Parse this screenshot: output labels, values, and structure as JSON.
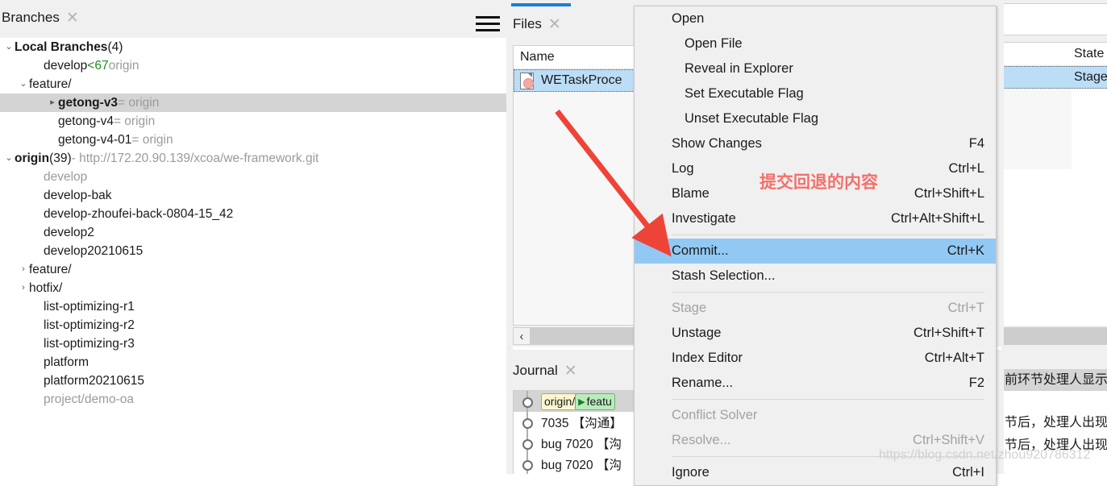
{
  "branches_panel": {
    "tab": {
      "label": "Branches",
      "close_icon": "close-icon",
      "close_glyph": "✕"
    },
    "menu_icon": "hamburger-menu-icon",
    "rows": [
      {
        "twisty": "⌄",
        "indent": 0,
        "text": "Local Branches",
        "bold": true,
        "suffix": " (4)",
        "selected": false
      },
      {
        "twisty": "",
        "indent": 2,
        "text": "develop",
        "bold": false,
        "ahead": "<67",
        "remote": "origin",
        "selected": false
      },
      {
        "twisty": "⌄",
        "indent": 1,
        "text": "feature/",
        "bold": false,
        "selected": false
      },
      {
        "twisty": "▸",
        "indent": 3,
        "text": "getong-v3",
        "bold": true,
        "eq": "= origin",
        "selected": true
      },
      {
        "twisty": "",
        "indent": 3,
        "text": "getong-v4",
        "bold": false,
        "eq": "= origin",
        "selected": false
      },
      {
        "twisty": "",
        "indent": 3,
        "text": "getong-v4-01",
        "bold": false,
        "eq": "= origin",
        "selected": false
      },
      {
        "twisty": "⌄",
        "indent": 0,
        "text": "origin",
        "bold": true,
        "suffix": " (39)",
        "url": "- http://172.20.90.139/xcoa/we-framework.git",
        "selected": false
      },
      {
        "twisty": "",
        "indent": 2,
        "text": "develop",
        "bold": false,
        "dim": true,
        "selected": false
      },
      {
        "twisty": "",
        "indent": 2,
        "text": "develop-bak",
        "bold": false,
        "selected": false
      },
      {
        "twisty": "",
        "indent": 2,
        "text": "develop-zhoufei-back-0804-15_42",
        "bold": false,
        "selected": false
      },
      {
        "twisty": "",
        "indent": 2,
        "text": "develop2",
        "bold": false,
        "selected": false
      },
      {
        "twisty": "",
        "indent": 2,
        "text": "develop20210615",
        "bold": false,
        "selected": false
      },
      {
        "twisty": "›",
        "indent": 1,
        "text": "feature/",
        "bold": false,
        "selected": false
      },
      {
        "twisty": "›",
        "indent": 1,
        "text": "hotfix/",
        "bold": false,
        "selected": false
      },
      {
        "twisty": "",
        "indent": 2,
        "text": "list-optimizing-r1",
        "bold": false,
        "selected": false
      },
      {
        "twisty": "",
        "indent": 2,
        "text": "list-optimizing-r2",
        "bold": false,
        "selected": false
      },
      {
        "twisty": "",
        "indent": 2,
        "text": "list-optimizing-r3",
        "bold": false,
        "selected": false
      },
      {
        "twisty": "",
        "indent": 2,
        "text": "platform",
        "bold": false,
        "selected": false
      },
      {
        "twisty": "",
        "indent": 2,
        "text": "platform20210615",
        "bold": false,
        "selected": false
      },
      {
        "twisty": "",
        "indent": 2,
        "text": "project/demo-oa",
        "bold": false,
        "dim": true,
        "selected": false
      }
    ]
  },
  "files_panel": {
    "tab": {
      "label": "Files",
      "close_icon": "close-icon",
      "close_glyph": "✕"
    },
    "columns": {
      "name": "Name",
      "state": "State"
    },
    "rows": [
      {
        "icon": "modified-file-icon",
        "name": "WETaskProce",
        "state": "Staged"
      }
    ],
    "hscroll": {
      "left_arrow_glyph": "‹"
    }
  },
  "journal_panel": {
    "tab": {
      "label": "Journal",
      "close_icon": "close-icon",
      "close_glyph": "✕"
    },
    "rows": [
      {
        "selected": true,
        "ref_local": "origin/",
        "ref_remote": "featu",
        "message": ""
      },
      {
        "selected": false,
        "message": "7035 【沟通】"
      },
      {
        "selected": false,
        "message": "bug 7020 【沟"
      },
      {
        "selected": false,
        "message": "bug 7020 【沟"
      }
    ]
  },
  "right_panel": {
    "column_header": "State",
    "row_value": "Staged",
    "text_lines": [
      {
        "text": "前环节处理人显示",
        "highlight": true
      },
      {
        "text": "节后，处理人出现",
        "highlight": false
      },
      {
        "text": "节后，处理人出现",
        "highlight": false
      }
    ]
  },
  "context_menu": {
    "items": [
      {
        "label": "Open",
        "accel": "",
        "state": "normal",
        "sub": false,
        "sep_after": false
      },
      {
        "label": "Open File",
        "accel": "",
        "state": "normal",
        "sub": true,
        "sep_after": false
      },
      {
        "label": "Reveal in Explorer",
        "accel": "",
        "state": "normal",
        "sub": true,
        "sep_after": false
      },
      {
        "label": "Set Executable Flag",
        "accel": "",
        "state": "normal",
        "sub": true,
        "sep_after": false
      },
      {
        "label": "Unset Executable Flag",
        "accel": "",
        "state": "normal",
        "sub": true,
        "sep_after": false
      },
      {
        "label": "Show Changes",
        "accel": "F4",
        "state": "normal",
        "sub": false,
        "sep_after": false
      },
      {
        "label": "Log",
        "accel": "Ctrl+L",
        "state": "normal",
        "sub": false,
        "sep_after": false
      },
      {
        "label": "Blame",
        "accel": "Ctrl+Shift+L",
        "state": "normal",
        "sub": false,
        "sep_after": false
      },
      {
        "label": "Investigate",
        "accel": "Ctrl+Alt+Shift+L",
        "state": "normal",
        "sub": false,
        "sep_after": true
      },
      {
        "label": "Commit...",
        "accel": "Ctrl+K",
        "state": "highlighted",
        "sub": false,
        "sep_after": false
      },
      {
        "label": "Stash Selection...",
        "accel": "",
        "state": "normal",
        "sub": false,
        "sep_after": true
      },
      {
        "label": "Stage",
        "accel": "Ctrl+T",
        "state": "disabled",
        "sub": false,
        "sep_after": false
      },
      {
        "label": "Unstage",
        "accel": "Ctrl+Shift+T",
        "state": "normal",
        "sub": false,
        "sep_after": false
      },
      {
        "label": "Index Editor",
        "accel": "Ctrl+Alt+T",
        "state": "normal",
        "sub": false,
        "sep_after": false
      },
      {
        "label": "Rename...",
        "accel": "F2",
        "state": "normal",
        "sub": false,
        "sep_after": true
      },
      {
        "label": "Conflict Solver",
        "accel": "",
        "state": "disabled",
        "sub": false,
        "sep_after": false
      },
      {
        "label": "Resolve...",
        "accel": "Ctrl+Shift+V",
        "state": "disabled",
        "sub": false,
        "sep_after": true
      },
      {
        "label": "Ignore",
        "accel": "Ctrl+I",
        "state": "normal",
        "sub": false,
        "sep_after": false
      }
    ]
  },
  "annotation": {
    "note_text": "提交回退的内容",
    "note_color": "#f4706a",
    "arrow_icon": "red-arrow-icon",
    "arrow_color": "#ee4438"
  },
  "watermark": {
    "text": "https://blog.csdn.net/zhou920786312"
  },
  "colors": {
    "selection_blue": "#bcddf6",
    "menu_highlight": "#92c9f4",
    "tab_accent": "#1a7fd4",
    "tree_selection_gray": "#d4d4d4",
    "panel_bg": "#f0f0f0",
    "ahead_green": "#1e8b22"
  }
}
